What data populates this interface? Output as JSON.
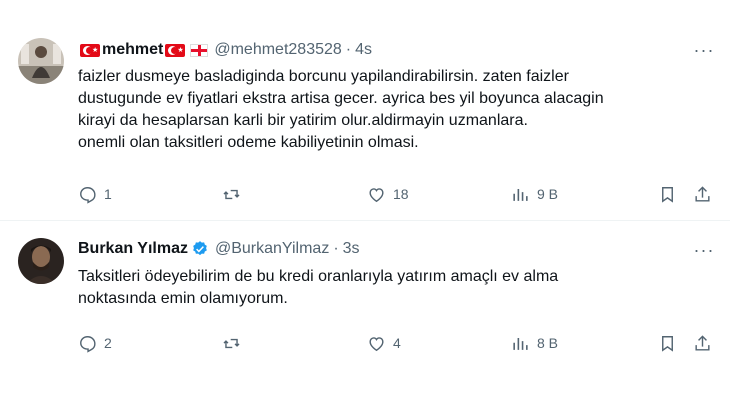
{
  "tweets": [
    {
      "name": "mehmet",
      "handle": "@mehmet283528",
      "separator": "·",
      "time": "4s",
      "lines": [
        "faizler dusmeye basladiginda borcunu yapilandirabilirsin. zaten faizler",
        "dustugunde ev fiyatlari ekstra artisa gecer. ayrica bes yil boyunca alacagin",
        "kirayi da hesaplarsan karli bir yatirim olur.aldirmayin uzmanlara.",
        "onemli olan taksitleri odeme kabiliyetinin olmasi."
      ],
      "replies": "1",
      "retweets": "",
      "likes": "18",
      "views": "9 B",
      "more": "···"
    },
    {
      "name": "Burkan Yılmaz",
      "handle": "@BurkanYilmaz",
      "separator": "·",
      "time": "3s",
      "lines": [
        "Taksitleri ödeyebilirim de bu kredi oranlarıyla yatırım amaçlı ev alma",
        "noktasında emin olamıyorum."
      ],
      "replies": "2",
      "retweets": "",
      "likes": "4",
      "views": "8 B",
      "more": "···"
    }
  ],
  "colors": {
    "text": "#0f1419",
    "muted": "#536471",
    "verified": "#1d9bf0",
    "flag_red": "#e30a17"
  },
  "icons": [
    "reply-icon",
    "retweet-icon",
    "like-icon",
    "views-icon",
    "bookmark-icon",
    "share-icon",
    "verified-badge-icon",
    "more-icon"
  ]
}
